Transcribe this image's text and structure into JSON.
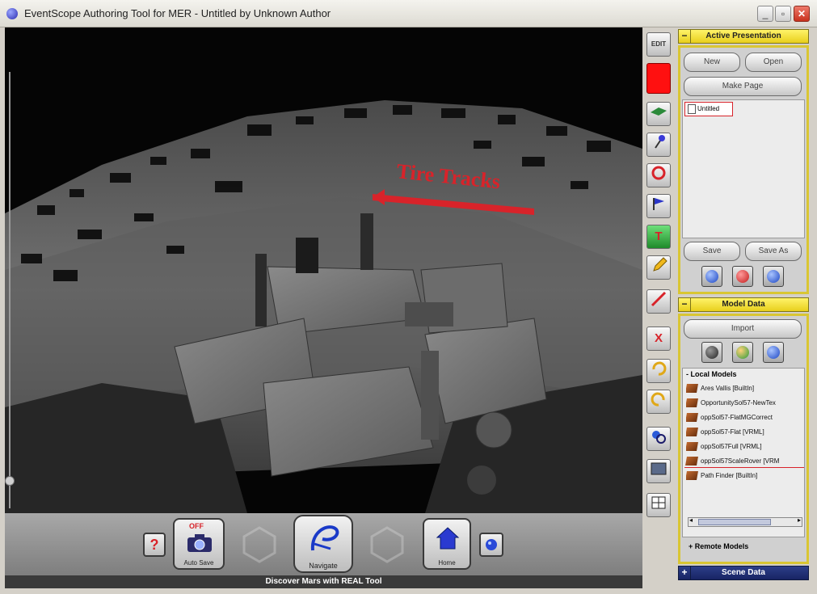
{
  "window": {
    "title": "EventScope Authoring Tool for MER - Untitled by Unknown Author",
    "minimize": "_",
    "maximize": "▫",
    "close": "✕"
  },
  "viewport": {
    "annotation_label": "Tire Tracks",
    "annotation_color": "#d8232a"
  },
  "toolbar": {
    "edit_label": "EDIT",
    "text_tool": "T",
    "delete_tool": "X"
  },
  "bottom": {
    "help": "?",
    "autosave_badge": "OFF",
    "autosave_label": "Auto Save",
    "navigate_label": "Navigate",
    "home_label": "Home",
    "status": "Discover Mars with REAL Tool"
  },
  "presentation": {
    "header": "Active Presentation",
    "toggle": "−",
    "new_label": "New",
    "open_label": "Open",
    "make_page_label": "Make Page",
    "items": [
      "Untitled"
    ],
    "save_label": "Save",
    "save_as_label": "Save As"
  },
  "model_data": {
    "header": "Model Data",
    "toggle": "−",
    "import_label": "Import",
    "local_header": "- Local Models",
    "local_models": [
      "Ares Vallis [BuiltIn]",
      "OpportunitySol57-NewTex",
      "oppSol57-FlatMGCorrect",
      "oppSol57-Flat [VRML]",
      "oppSol57Full [VRML]",
      "oppSol57ScaleRover [VRM",
      "Path Finder [BuiltIn]"
    ],
    "remote_header": "+ Remote Models"
  },
  "scene_data": {
    "header": "Scene Data",
    "toggle": "+"
  }
}
